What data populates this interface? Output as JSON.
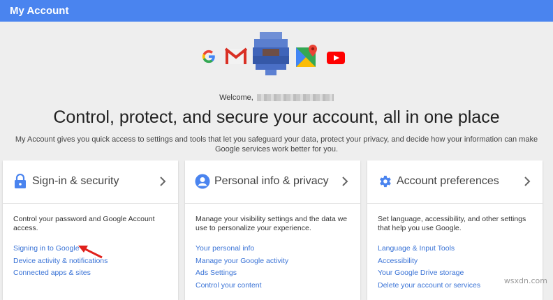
{
  "app": {
    "title": "My Account"
  },
  "icons": [
    "google-g-icon",
    "gmail-icon",
    "google-maps-icon",
    "youtube-icon"
  ],
  "welcome": {
    "label": "Welcome,"
  },
  "headline": "Control, protect, and secure your account, all in one place",
  "intro": "My Account gives you quick access to settings and tools that let you safeguard your data, protect your privacy, and decide how your information can make Google services work better for you.",
  "cards": [
    {
      "icon": "lock-icon",
      "title": "Sign-in & security",
      "description": "Control your password and Google Account access.",
      "links": [
        "Signing in to Google",
        "Device activity & notifications",
        "Connected apps & sites"
      ]
    },
    {
      "icon": "person-icon",
      "title": "Personal info & privacy",
      "description": "Manage your visibility settings and the data we use to personalize your experience.",
      "links": [
        "Your personal info",
        "Manage your Google activity",
        "Ads Settings",
        "Control your content"
      ]
    },
    {
      "icon": "gear-icon",
      "title": "Account preferences",
      "description": "Set language, accessibility, and other settings that help you use Google.",
      "links": [
        "Language & Input Tools",
        "Accessibility",
        "Your Google Drive storage",
        "Delete your account or services"
      ]
    }
  ],
  "watermark": "wsxdn.com",
  "colors": {
    "topbar": "#4a84ef",
    "link": "#3a73d6",
    "arrow": "#e0201b",
    "page_bg": "#eeeeee"
  }
}
